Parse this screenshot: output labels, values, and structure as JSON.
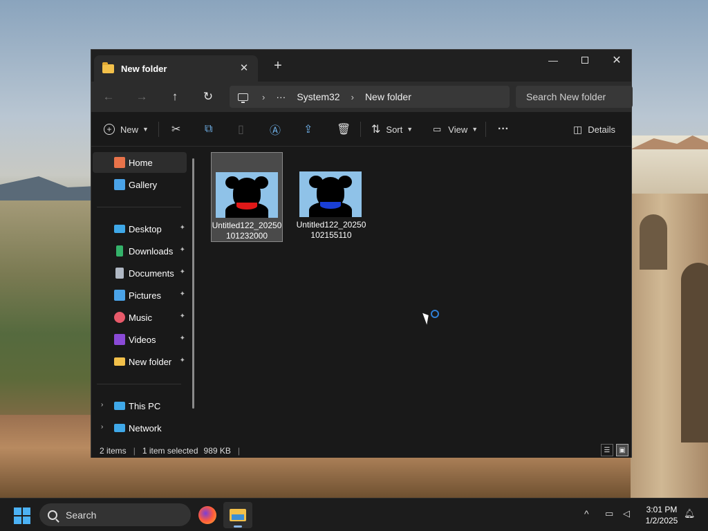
{
  "window": {
    "tab_title": "New folder",
    "tab_close": "✕",
    "new_tab": "+",
    "controls": {
      "minimize": "—",
      "close": "✕"
    }
  },
  "nav": {
    "back": "←",
    "forward": "→",
    "up": "↑",
    "refresh": "↻"
  },
  "address": {
    "more": "···",
    "crumbs": [
      "System32",
      "New folder"
    ],
    "separator": "›"
  },
  "search": {
    "placeholder": "Search New folder"
  },
  "toolbar": {
    "new_label": "New",
    "sort_label": "Sort",
    "view_label": "View",
    "more_label": "···",
    "details_label": "Details",
    "icons": [
      "cut-icon",
      "copy-icon",
      "paste-icon",
      "rename-icon",
      "share-icon",
      "delete-icon"
    ]
  },
  "sidebar": {
    "items": [
      {
        "label": "Home",
        "icon": "home-icon",
        "color": "#e8734a"
      },
      {
        "label": "Gallery",
        "icon": "gallery-icon",
        "color": "#4aa3e8"
      },
      {
        "label": "Desktop",
        "icon": "desktop-icon",
        "color": "#3fa8e8"
      },
      {
        "label": "Downloads",
        "icon": "download-icon",
        "color": "#34b26a"
      },
      {
        "label": "Documents",
        "icon": "documents-icon",
        "color": "#b0b8c4"
      },
      {
        "label": "Pictures",
        "icon": "pictures-icon",
        "color": "#4aa3e8"
      },
      {
        "label": "Music",
        "icon": "music-icon",
        "color": "#e85a6a"
      },
      {
        "label": "Videos",
        "icon": "videos-icon",
        "color": "#8a4ad6"
      },
      {
        "label": "New folder",
        "icon": "folder-icon",
        "color": "#f2c04a"
      },
      {
        "label": "This PC",
        "icon": "this-pc-icon",
        "color": "#3fa8e8"
      },
      {
        "label": "Network",
        "icon": "network-icon",
        "color": "#3fa8e8"
      }
    ],
    "pin": "📌",
    "expand": "›"
  },
  "files": [
    {
      "name": "Untitled122_20250101232000",
      "scarf": "#e01818",
      "selected": true
    },
    {
      "name": "Untitled122_20250102155110",
      "scarf": "#1a3fd6",
      "selected": false
    }
  ],
  "status": {
    "count": "2 items",
    "selected": "1 item selected",
    "size": "989 KB",
    "sep": "|"
  },
  "taskbar": {
    "search_label": "Search",
    "tray_chevron": "^",
    "time": "3:01 PM",
    "date": "1/2/2025"
  }
}
